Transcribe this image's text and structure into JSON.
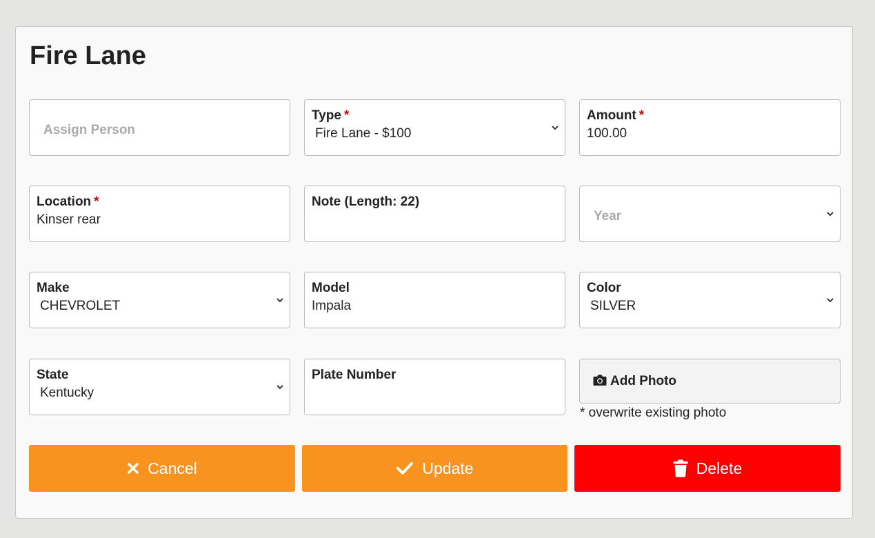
{
  "page": {
    "title": "Fire Lane"
  },
  "form": {
    "assign_person": {
      "placeholder": "Assign Person"
    },
    "type": {
      "label": "Type",
      "required": "*",
      "value": "Fire Lane - $100"
    },
    "amount": {
      "label": "Amount",
      "required": "*",
      "value": "100.00"
    },
    "location": {
      "label": "Location",
      "required": "*",
      "value": "Kinser rear"
    },
    "note": {
      "label": "Note (Length: 22)"
    },
    "year": {
      "placeholder": "Year"
    },
    "make": {
      "label": "Make",
      "value": "CHEVROLET"
    },
    "model": {
      "label": "Model",
      "value": "Impala"
    },
    "color": {
      "label": "Color",
      "value": "SILVER"
    },
    "state": {
      "label": "State",
      "value": "Kentucky"
    },
    "plate": {
      "label": "Plate Number"
    },
    "photo": {
      "label": "Add Photo",
      "note": "* overwrite existing photo",
      "icon": "camera-icon"
    }
  },
  "actions": {
    "cancel": {
      "label": "Cancel",
      "icon": "close-icon",
      "color": "#f7931e"
    },
    "update": {
      "label": "Update",
      "icon": "check-icon",
      "color": "#f7931e"
    },
    "delete": {
      "label": "Delete",
      "icon": "trash-icon",
      "color": "#ff0000"
    }
  }
}
